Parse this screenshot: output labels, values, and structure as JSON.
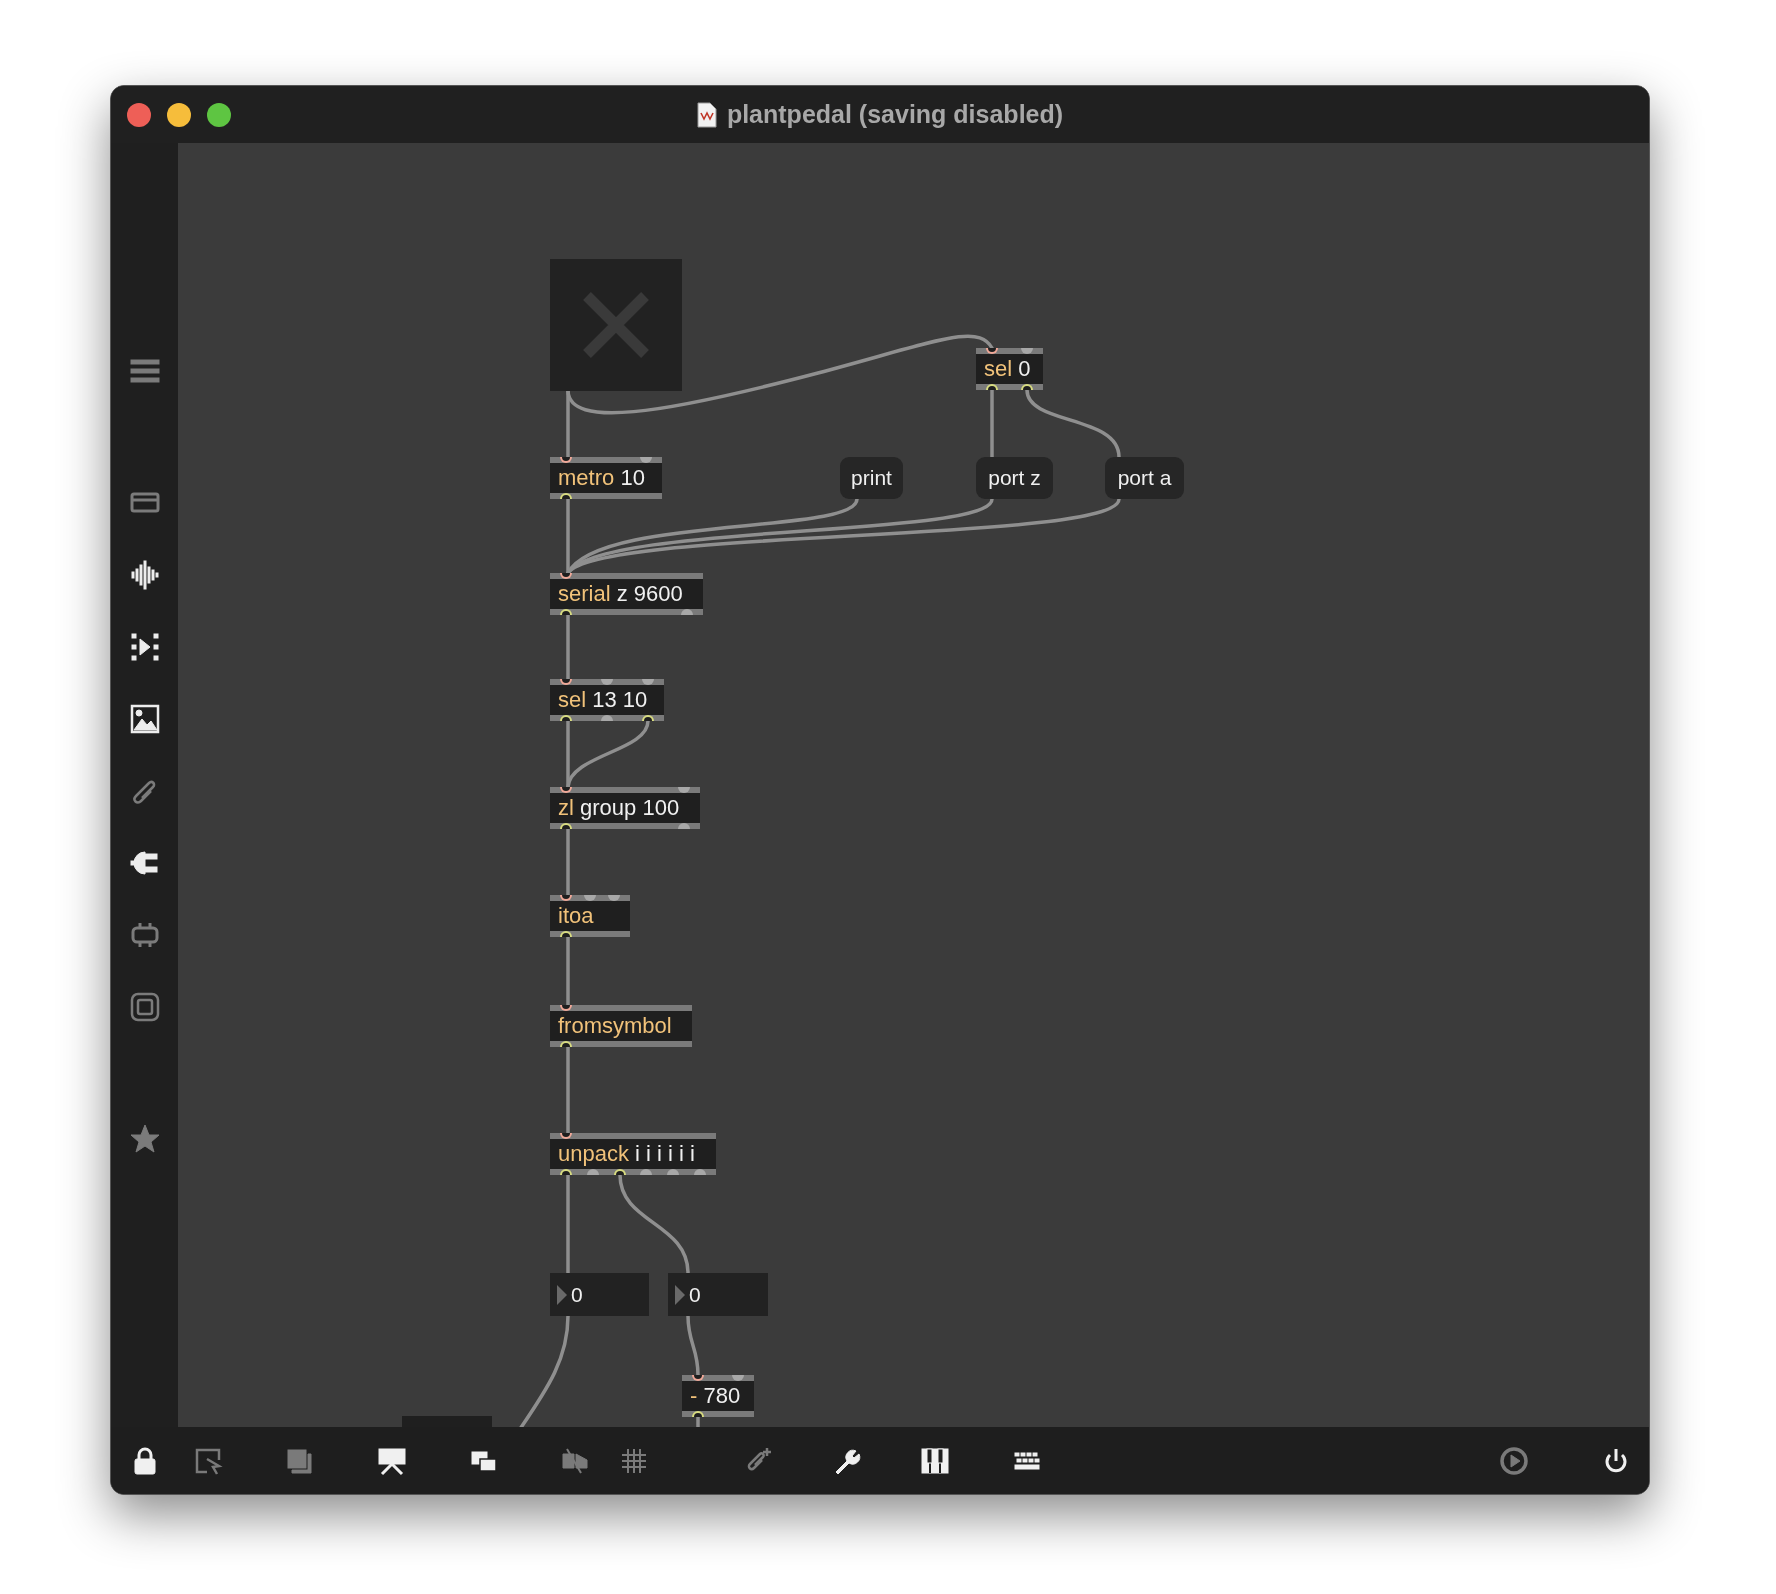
{
  "window": {
    "title": "plantpedal (saving disabled)"
  },
  "sidebar": {
    "items": [
      {
        "highlighted": false
      },
      {
        "highlighted": false
      },
      {
        "highlighted": true
      },
      {
        "highlighted": true
      },
      {
        "highlighted": true
      },
      {
        "highlighted": false
      },
      {
        "highlighted": true
      },
      {
        "highlighted": false
      },
      {
        "highlighted": false
      },
      {
        "highlighted": false
      }
    ]
  },
  "patch": {
    "objects": [
      {
        "kind": "toggle",
        "on": false
      },
      {
        "kind": "object",
        "class": "sel",
        "args": "0",
        "inlets": [
          true,
          false
        ],
        "outlets": [
          true,
          true
        ]
      },
      {
        "kind": "object",
        "class": "metro",
        "args": "10",
        "inlets": [
          true,
          false
        ],
        "outlets": [
          true
        ]
      },
      {
        "kind": "message",
        "text": "print"
      },
      {
        "kind": "message",
        "text": "port z"
      },
      {
        "kind": "message",
        "text": "port a"
      },
      {
        "kind": "object",
        "class": "serial",
        "args": "z 9600",
        "inlets": [
          true
        ],
        "outlets": [
          true,
          false
        ]
      },
      {
        "kind": "object",
        "class": "sel",
        "args": "13 10",
        "inlets": [
          true,
          false,
          false
        ],
        "outlets": [
          true,
          false,
          true
        ]
      },
      {
        "kind": "object",
        "class": "zl",
        "args": "group 100",
        "inlets": [
          true,
          false
        ],
        "outlets": [
          true,
          false
        ]
      },
      {
        "kind": "object",
        "class": "itoa",
        "inlets": [
          true,
          false,
          false
        ],
        "outlets": [
          true
        ]
      },
      {
        "kind": "object",
        "class": "fromsymbol",
        "inlets": [
          true
        ],
        "outlets": [
          true
        ]
      },
      {
        "kind": "object",
        "class": "unpack",
        "args": "i i i i i i",
        "inlets": [
          true
        ],
        "outlets": [
          true,
          false,
          true,
          false,
          false,
          false
        ]
      },
      {
        "kind": "number",
        "value": "0"
      },
      {
        "kind": "number",
        "value": "0"
      },
      {
        "kind": "object",
        "class": "-",
        "args": "780",
        "inlets": [
          true,
          false
        ],
        "outlets": [
          true
        ]
      },
      {
        "kind": "stub"
      }
    ]
  },
  "toolbar": {
    "items": [
      {
        "disabled": false
      },
      {
        "disabled": true
      },
      {
        "disabled": true
      },
      {
        "disabled": false
      },
      {
        "disabled": false
      },
      {
        "disabled": true
      },
      {
        "disabled": true
      },
      {
        "disabled": true
      },
      {
        "disabled": false
      },
      {
        "disabled": false
      },
      {
        "disabled": false
      },
      {
        "disabled": true
      },
      {
        "disabled": false
      }
    ]
  }
}
